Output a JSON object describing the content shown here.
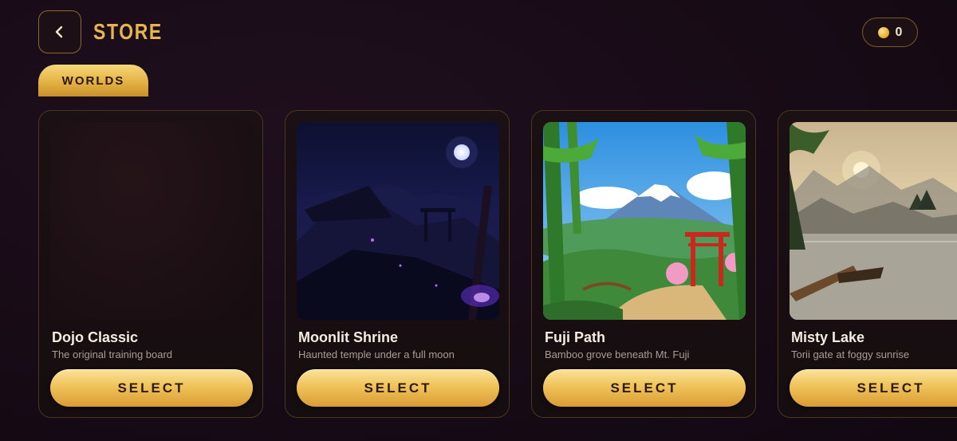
{
  "header": {
    "back_icon": "chevron-left-icon",
    "title": "STORE",
    "coin_icon": "coin-icon",
    "coin_count": "0"
  },
  "tabs": [
    {
      "label": "WORLDS",
      "active": true
    }
  ],
  "colors": {
    "accent_gold": "#e6b552",
    "background": "#170b16",
    "card_border": "#4b3720"
  },
  "worlds": [
    {
      "name": "Dojo Classic",
      "description": "The original training board",
      "button_label": "SELECT"
    },
    {
      "name": "Moonlit Shrine",
      "description": "Haunted temple under a full moon",
      "button_label": "SELECT"
    },
    {
      "name": "Fuji Path",
      "description": "Bamboo grove beneath Mt. Fuji",
      "button_label": "SELECT"
    },
    {
      "name": "Misty Lake",
      "description": "Torii gate at foggy sunrise",
      "button_label": "SELECT"
    }
  ]
}
